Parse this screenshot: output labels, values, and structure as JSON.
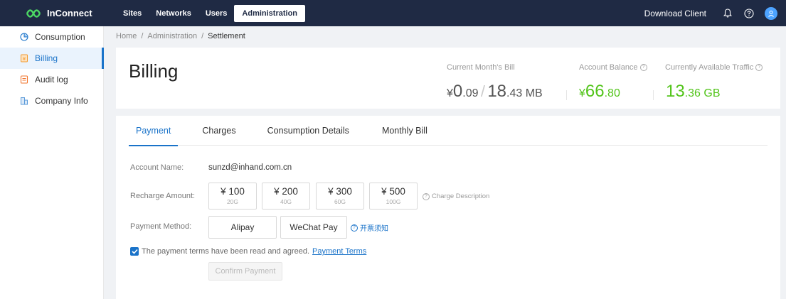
{
  "app": {
    "name": "InConnect"
  },
  "topnav": {
    "items": [
      {
        "label": "Sites",
        "active": false
      },
      {
        "label": "Networks",
        "active": false
      },
      {
        "label": "Users",
        "active": false
      },
      {
        "label": "Administration",
        "active": true
      }
    ],
    "download_label": "Download Client",
    "icons": [
      "bell-icon",
      "help-icon",
      "user-avatar-icon"
    ]
  },
  "sidebar": {
    "items": [
      {
        "label": "Consumption",
        "icon": "pie-chart-icon",
        "active": false
      },
      {
        "label": "Billing",
        "icon": "bill-icon",
        "active": true
      },
      {
        "label": "Audit log",
        "icon": "audit-log-icon",
        "active": false
      },
      {
        "label": "Company Info",
        "icon": "building-icon",
        "active": false
      }
    ]
  },
  "breadcrumb": {
    "items": [
      "Home",
      "/",
      "Administration",
      "/",
      "Settlement"
    ]
  },
  "header": {
    "title": "Billing",
    "current_bill": {
      "label": "Current Month's Bill",
      "currency": "¥",
      "amount_int": "0",
      "amount_dec": ".09",
      "separator": "/",
      "traffic_int": "18",
      "traffic_dec": ".43 MB"
    },
    "balance": {
      "label": "Account Balance",
      "currency": "¥",
      "amount_int": "66",
      "amount_dec": ".80"
    },
    "traffic": {
      "label": "Currently Available Traffic",
      "value_int": "13",
      "value_dec": ".36 GB"
    }
  },
  "tabs": [
    {
      "label": "Payment",
      "active": true
    },
    {
      "label": "Charges",
      "active": false
    },
    {
      "label": "Consumption Details",
      "active": false
    },
    {
      "label": "Monthly Bill",
      "active": false
    }
  ],
  "form": {
    "account_label": "Account Name:",
    "account_value": "sunzd@inhand.com.cn",
    "recharge_label": "Recharge Amount:",
    "amounts": [
      {
        "price": "¥ 100",
        "traffic": "20G"
      },
      {
        "price": "¥ 200",
        "traffic": "40G"
      },
      {
        "price": "¥ 300",
        "traffic": "60G"
      },
      {
        "price": "¥ 500",
        "traffic": "100G"
      }
    ],
    "charge_description": "Charge Description",
    "method_label": "Payment Method:",
    "methods": [
      "Alipay",
      "WeChat Pay"
    ],
    "invoice_notice": "开票须知",
    "agree_text": "The payment terms have been read and agreed.",
    "terms_link": "Payment Terms",
    "agreed": true,
    "confirm_label": "Confirm Payment"
  },
  "colors": {
    "topbar": "#1f2a44",
    "accent": "#1a73c9",
    "green": "#52c41a"
  }
}
